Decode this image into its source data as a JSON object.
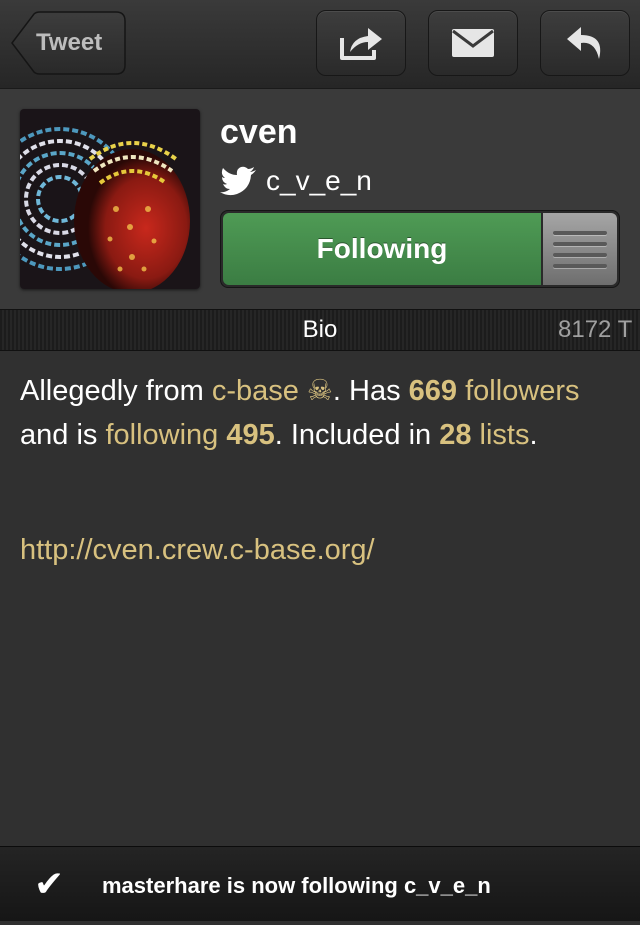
{
  "toolbar": {
    "back_label": "Tweet",
    "buttons": [
      {
        "name": "share",
        "icon": "share-arrow-icon"
      },
      {
        "name": "mail",
        "icon": "envelope-icon"
      },
      {
        "name": "reply",
        "icon": "reply-arrow-icon"
      }
    ]
  },
  "profile": {
    "display_name": "cven",
    "handle": "c_v_e_n",
    "handle_icon": "twitter-bird-icon",
    "follow_button_label": "Following",
    "follow_menu_icon": "list-lines-icon"
  },
  "tabs": {
    "active": "Bio",
    "next_partial": "8172 T"
  },
  "bio": {
    "t1": "Allegedly from ",
    "link_cbase": "c-base ☠",
    "t2": ". Has ",
    "followers_count": "669",
    "followers_label": "followers",
    "t3": " and is ",
    "following_label": "following",
    "following_count": "495",
    "t4": ". Included in ",
    "lists_count": "28",
    "lists_label": "lists",
    "t5": ".",
    "url": "http://cven.crew.c-base.org/"
  },
  "notification": {
    "icon": "checkmark-icon",
    "check_glyph": "✔",
    "text": "masterhare is now following c_v_e_n"
  },
  "colors": {
    "accent_link": "#d8c17f",
    "follow_green": "#46894c",
    "background": "#303030"
  }
}
